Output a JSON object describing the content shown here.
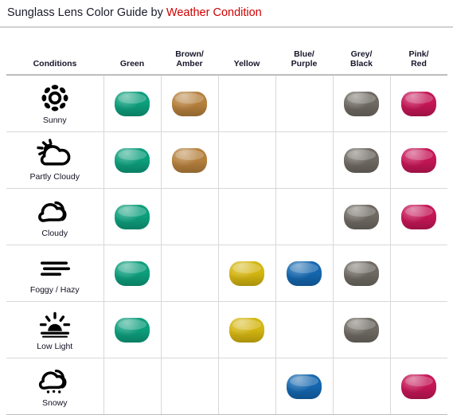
{
  "title": {
    "main": "Sunglass Lens Color Guide by ",
    "accent": "Weather Condition"
  },
  "table": {
    "columns": [
      {
        "id": "conditions",
        "label_line1": "Conditions",
        "label_line2": ""
      },
      {
        "id": "green",
        "label_line1": "Green",
        "label_line2": ""
      },
      {
        "id": "brown",
        "label_line1": "Brown/",
        "label_line2": "Amber"
      },
      {
        "id": "yellow",
        "label_line1": "Yellow",
        "label_line2": ""
      },
      {
        "id": "blue",
        "label_line1": "Blue/",
        "label_line2": "Purple"
      },
      {
        "id": "grey",
        "label_line1": "Grey/",
        "label_line2": "Black"
      },
      {
        "id": "pink",
        "label_line1": "Pink/",
        "label_line2": "Red"
      }
    ],
    "lens_colors": {
      "green": "#0d9e7c",
      "brown": "#b5803d",
      "yellow": "#d4b510",
      "blue": "#1466ae",
      "grey": "#6e6962",
      "pink": "#c41655"
    },
    "rows": [
      {
        "id": "sunny",
        "icon": "sun-icon",
        "label": "Sunny",
        "cells": {
          "green": true,
          "brown": true,
          "yellow": false,
          "blue": false,
          "grey": true,
          "pink": true
        }
      },
      {
        "id": "partly-cloudy",
        "icon": "sun-behind-cloud-icon",
        "label": "Partly Cloudy",
        "cells": {
          "green": true,
          "brown": true,
          "yellow": false,
          "blue": false,
          "grey": true,
          "pink": true
        }
      },
      {
        "id": "cloudy",
        "icon": "cloud-icon",
        "label": "Cloudy",
        "cells": {
          "green": true,
          "brown": false,
          "yellow": false,
          "blue": false,
          "grey": true,
          "pink": true
        }
      },
      {
        "id": "foggy-hazy",
        "icon": "fog-bars-icon",
        "label": "Foggy / Hazy",
        "cells": {
          "green": true,
          "brown": false,
          "yellow": true,
          "blue": true,
          "grey": true,
          "pink": false
        }
      },
      {
        "id": "low-light",
        "icon": "sunset-icon",
        "label": "Low Light",
        "cells": {
          "green": true,
          "brown": false,
          "yellow": true,
          "blue": false,
          "grey": true,
          "pink": false
        }
      },
      {
        "id": "snowy",
        "icon": "snow-cloud-icon",
        "label": "Snowy",
        "cells": {
          "green": false,
          "brown": false,
          "yellow": false,
          "blue": true,
          "grey": false,
          "pink": true
        }
      }
    ]
  },
  "colors": {
    "title_accent": "#d10000",
    "title_main": "#1b1b2b",
    "grid_line": "#d8d8d8",
    "header_rule": "#bdbdbd"
  }
}
